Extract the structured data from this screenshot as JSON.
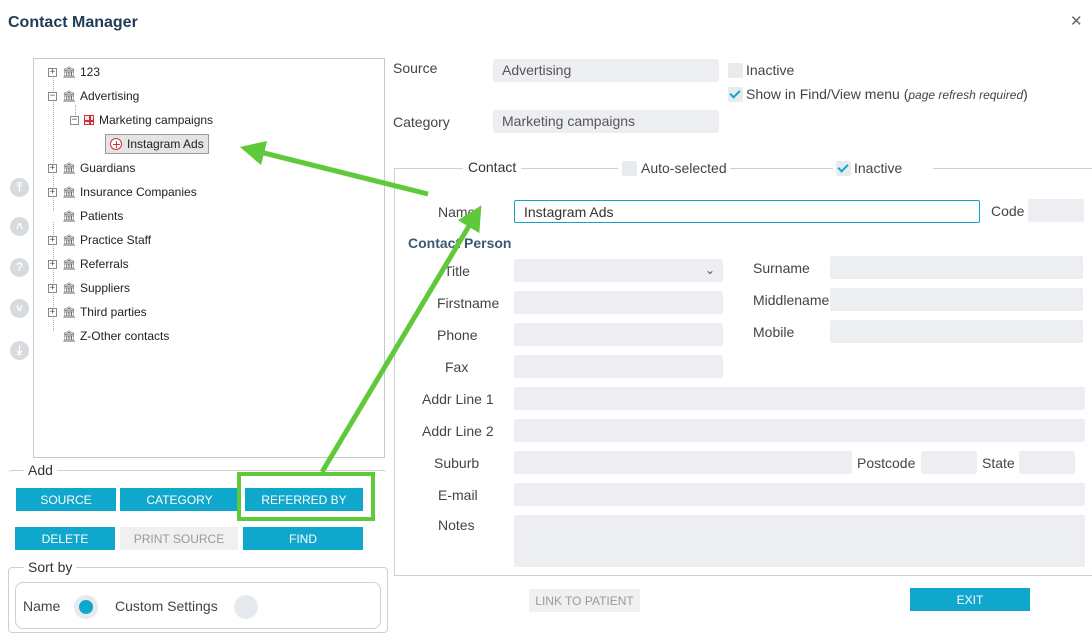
{
  "window": {
    "title": "Contact Manager"
  },
  "tree": {
    "items": [
      {
        "label": "123"
      },
      {
        "label": "Advertising"
      },
      {
        "label": "Marketing campaigns"
      },
      {
        "label": "Instagram Ads"
      },
      {
        "label": "Guardians"
      },
      {
        "label": "Insurance Companies"
      },
      {
        "label": "Patients"
      },
      {
        "label": "Practice Staff"
      },
      {
        "label": "Referrals"
      },
      {
        "label": "Suppliers"
      },
      {
        "label": "Third parties"
      },
      {
        "label": "Z-Other contacts"
      }
    ]
  },
  "add": {
    "legend": "Add",
    "source_label": "SOURCE",
    "category_label": "CATEGORY",
    "referred_by_label": "REFERRED BY"
  },
  "actions": {
    "delete_label": "DELETE",
    "print_source_label": "PRINT SOURCE",
    "find_label": "FIND"
  },
  "sort": {
    "legend": "Sort by",
    "name_label": "Name",
    "custom_label": "Custom Settings",
    "selected": "Name"
  },
  "source": {
    "source_label": "Source",
    "source_value": "Advertising",
    "inactive_label": "Inactive",
    "show_in_find": "Show in Find/View menu (",
    "show_in_find_note": "page refresh required",
    "show_in_find_close": ")",
    "category_label": "Category",
    "category_value": "Marketing campaigns"
  },
  "contact": {
    "legend": "Contact",
    "auto_selected_label": "Auto-selected",
    "inactive_label": "Inactive",
    "name_label": "Name",
    "name_value": "Instagram Ads",
    "code_label": "Code",
    "contact_person_label": "Contact Person",
    "title_label": "Title",
    "surname_label": "Surname",
    "firstname_label": "Firstname",
    "middlename_label": "Middlename",
    "phone_label": "Phone",
    "mobile_label": "Mobile",
    "fax_label": "Fax",
    "addr1_label": "Addr Line 1",
    "addr2_label": "Addr Line 2",
    "suburb_label": "Suburb",
    "postcode_label": "Postcode",
    "state_label": "State",
    "email_label": "E-mail",
    "notes_label": "Notes"
  },
  "footer": {
    "link_to_patient_label": "LINK TO PATIENT",
    "exit_label": "EXIT"
  },
  "colors": {
    "accent": "#10a7cc",
    "highlight_green": "#5fc93a"
  }
}
